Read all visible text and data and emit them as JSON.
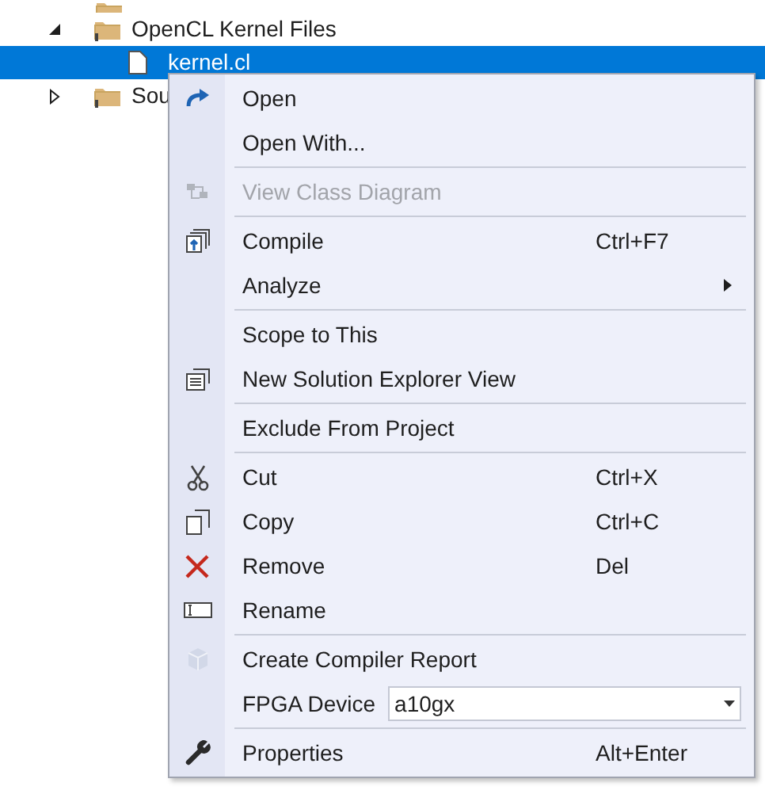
{
  "tree": [
    {
      "label": "OpenCL Kernel Files",
      "expanded": true,
      "selected": false,
      "children": [
        {
          "label": "kernel.cl",
          "selected": true
        }
      ]
    },
    {
      "label": "Sou",
      "expanded": false,
      "selected": false
    }
  ],
  "context_menu": {
    "items": [
      {
        "kind": "item",
        "label": "Open",
        "disabled": false
      },
      {
        "kind": "item",
        "label": "Open With...",
        "disabled": false
      },
      {
        "kind": "separator"
      },
      {
        "kind": "item",
        "label": "View Class Diagram",
        "disabled": true
      },
      {
        "kind": "separator"
      },
      {
        "kind": "item",
        "label": "Compile",
        "shortcut": "Ctrl+F7",
        "disabled": false
      },
      {
        "kind": "item",
        "label": "Analyze",
        "submenu": true,
        "disabled": false
      },
      {
        "kind": "separator"
      },
      {
        "kind": "item",
        "label": "Scope to This",
        "disabled": false
      },
      {
        "kind": "item",
        "label": "New Solution Explorer View",
        "disabled": false
      },
      {
        "kind": "separator"
      },
      {
        "kind": "item",
        "label": "Exclude From Project",
        "disabled": false
      },
      {
        "kind": "separator"
      },
      {
        "kind": "item",
        "label": "Cut",
        "shortcut": "Ctrl+X",
        "disabled": false
      },
      {
        "kind": "item",
        "label": "Copy",
        "shortcut": "Ctrl+C",
        "disabled": false
      },
      {
        "kind": "item",
        "label": "Remove",
        "shortcut": "Del",
        "disabled": false
      },
      {
        "kind": "item",
        "label": "Rename",
        "disabled": false
      },
      {
        "kind": "separator"
      },
      {
        "kind": "item",
        "label": "Create Compiler Report",
        "disabled": false
      },
      {
        "kind": "combo",
        "label": "FPGA Device",
        "value": "a10gx"
      },
      {
        "kind": "separator"
      },
      {
        "kind": "item",
        "label": "Properties",
        "shortcut": "Alt+Enter",
        "disabled": false
      }
    ]
  }
}
